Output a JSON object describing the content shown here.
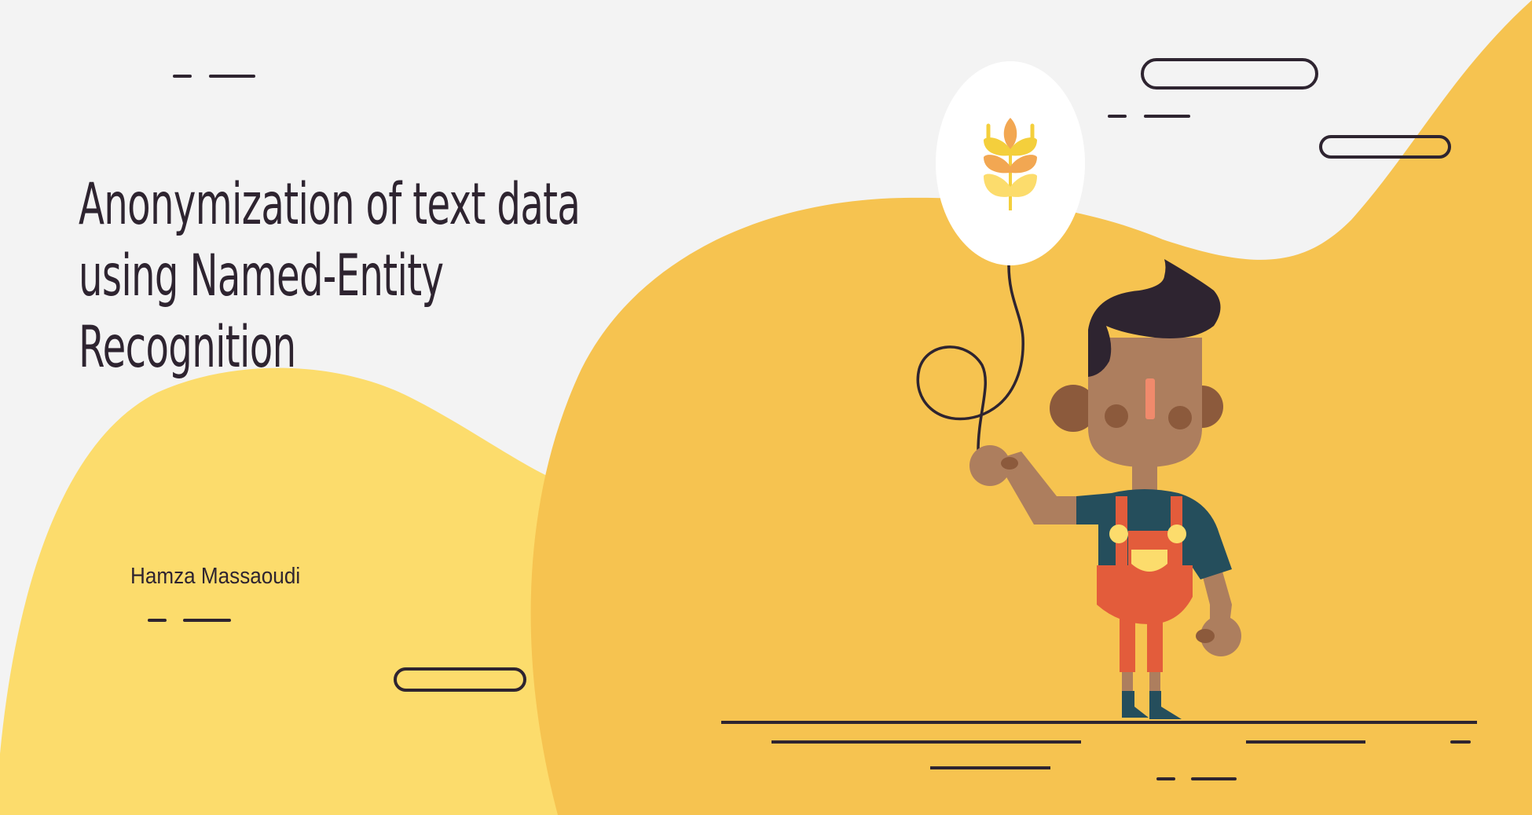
{
  "slide": {
    "title": "Anonymization of text data using Named-Entity Recognition",
    "author": "Hamza Massaoudi"
  },
  "colors": {
    "background": "#f3f3f3",
    "blob_light": "#fcdc6c",
    "blob_main": "#f6c350",
    "ink": "#2e2430",
    "skin": "#ad7e5e",
    "shirt": "#254e5c",
    "overalls": "#e35c3b",
    "balloon": "#ffffff"
  },
  "illustration": {
    "figure": "boy-holding-balloon",
    "balloon_icon": "wheat-icon"
  }
}
